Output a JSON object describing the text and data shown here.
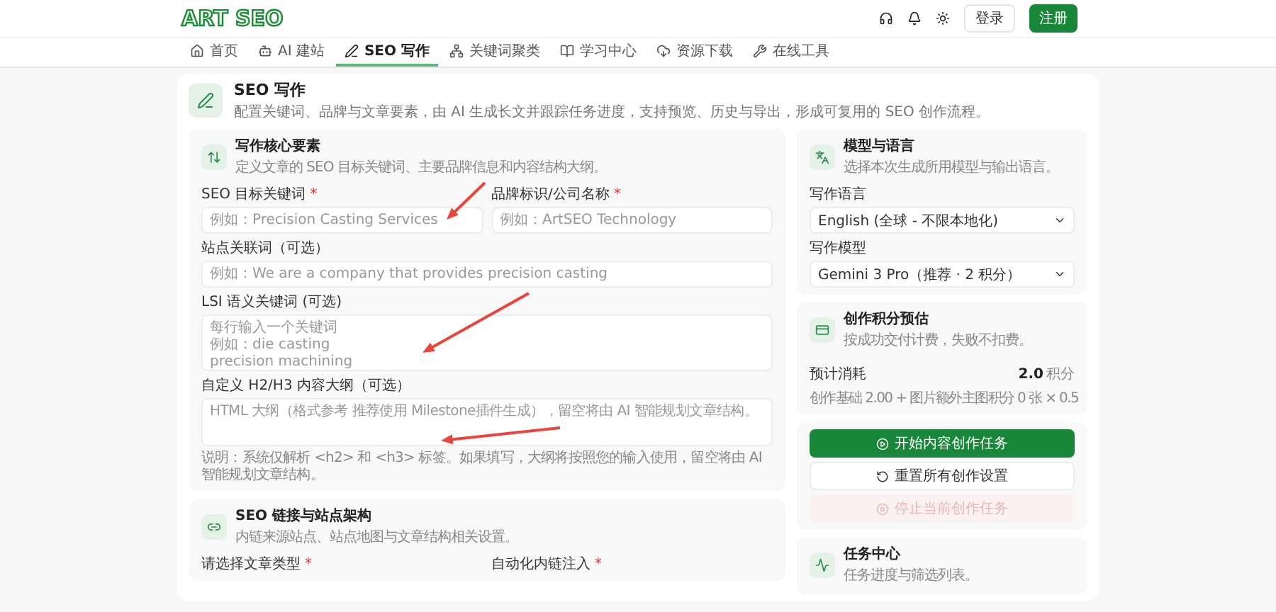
{
  "header": {
    "logo": "ART SEO",
    "login": "登录",
    "register": "注册"
  },
  "nav": [
    {
      "label": "首页",
      "selected": false
    },
    {
      "label": "AI 建站",
      "selected": false
    },
    {
      "label": "SEO 写作",
      "selected": true
    },
    {
      "label": "关键词聚类",
      "selected": false
    },
    {
      "label": "学习中心",
      "selected": false
    },
    {
      "label": "资源下载",
      "selected": false
    },
    {
      "label": "在线工具",
      "selected": false
    }
  ],
  "page_header": {
    "title": "SEO 写作",
    "subtitle": "配置关键词、品牌与文章要素，由 AI 生成长文并跟踪任务进度，支持预览、历史与导出，形成可复用的 SEO 创作流程。"
  },
  "core_card": {
    "title": "写作核心要素",
    "subtitle": "定义文章的 SEO 目标关键词、主要品牌信息和内容结构大纲。",
    "fields": [
      {
        "kind": "input",
        "label": "SEO 目标关键词",
        "mark": "*",
        "placeholder": "例如：Precision Casting Services"
      },
      {
        "kind": "input",
        "label": "品牌标识/公司名称",
        "mark": "*",
        "placeholder": "例如：ArtSEO Technology"
      },
      {
        "kind": "input",
        "label": "站点关联词（可选）",
        "placeholder": "例如：We are a company that provides precision casting"
      },
      {
        "kind": "textarea",
        "label": "LSI 语义关键词 (可选)",
        "placeholder_lines": [
          "每行输入一个关键词",
          "例如：die casting",
          "precision machining"
        ]
      },
      {
        "kind": "textarea",
        "label": "自定义 H2/H3 内容大纲（可选）",
        "placeholder": "HTML 大纲（格式参考 推荐使用 Milestone插件生成），留空将由 AI 智能规划文章结构。"
      }
    ],
    "note": "说明：系统仅解析 <h2> 和 <h3> 标签。如果填写，大纲将按照您的输入使用，留空将由 AI 智能规划文章结构。"
  },
  "link_card": {
    "title": "SEO 链接与站点架构",
    "subtitle": "内链来源站点、站点地图与文章结构相关设置。",
    "labels": [
      {
        "text": "请选择文章类型",
        "mark": "*"
      },
      {
        "text": "自动化内链注入",
        "mark": "*"
      }
    ]
  },
  "model_card": {
    "title": "模型与语言",
    "subtitle": "选择本次生成所用模型与输出语言。",
    "selects": [
      {
        "label": "写作语言",
        "value": "English (全球 - 不限本地化)"
      },
      {
        "label": "写作模型",
        "value": "Gemini 3 Pro（推荐 · 2 积分）"
      }
    ]
  },
  "credit_card": {
    "title": "创作积分预估",
    "subtitle": "按成功交付计费，失败不扣费。",
    "cost_label": "预计消耗",
    "cost_value": "2.0",
    "cost_unit": "积分",
    "formula": "创作基础 2.00 + 图片额外主图积分 0 张 × 0.5"
  },
  "actions": [
    {
      "kind": "primary",
      "label": "开始内容创作任务",
      "disabled": false
    },
    {
      "kind": "secondary",
      "label": "重置所有创作设置",
      "disabled": false
    },
    {
      "kind": "danger",
      "label": "停止当前创作任务",
      "disabled": true
    }
  ],
  "task_card": {
    "title": "任务中心",
    "subtitle": "任务进度与筛选列表。"
  }
}
